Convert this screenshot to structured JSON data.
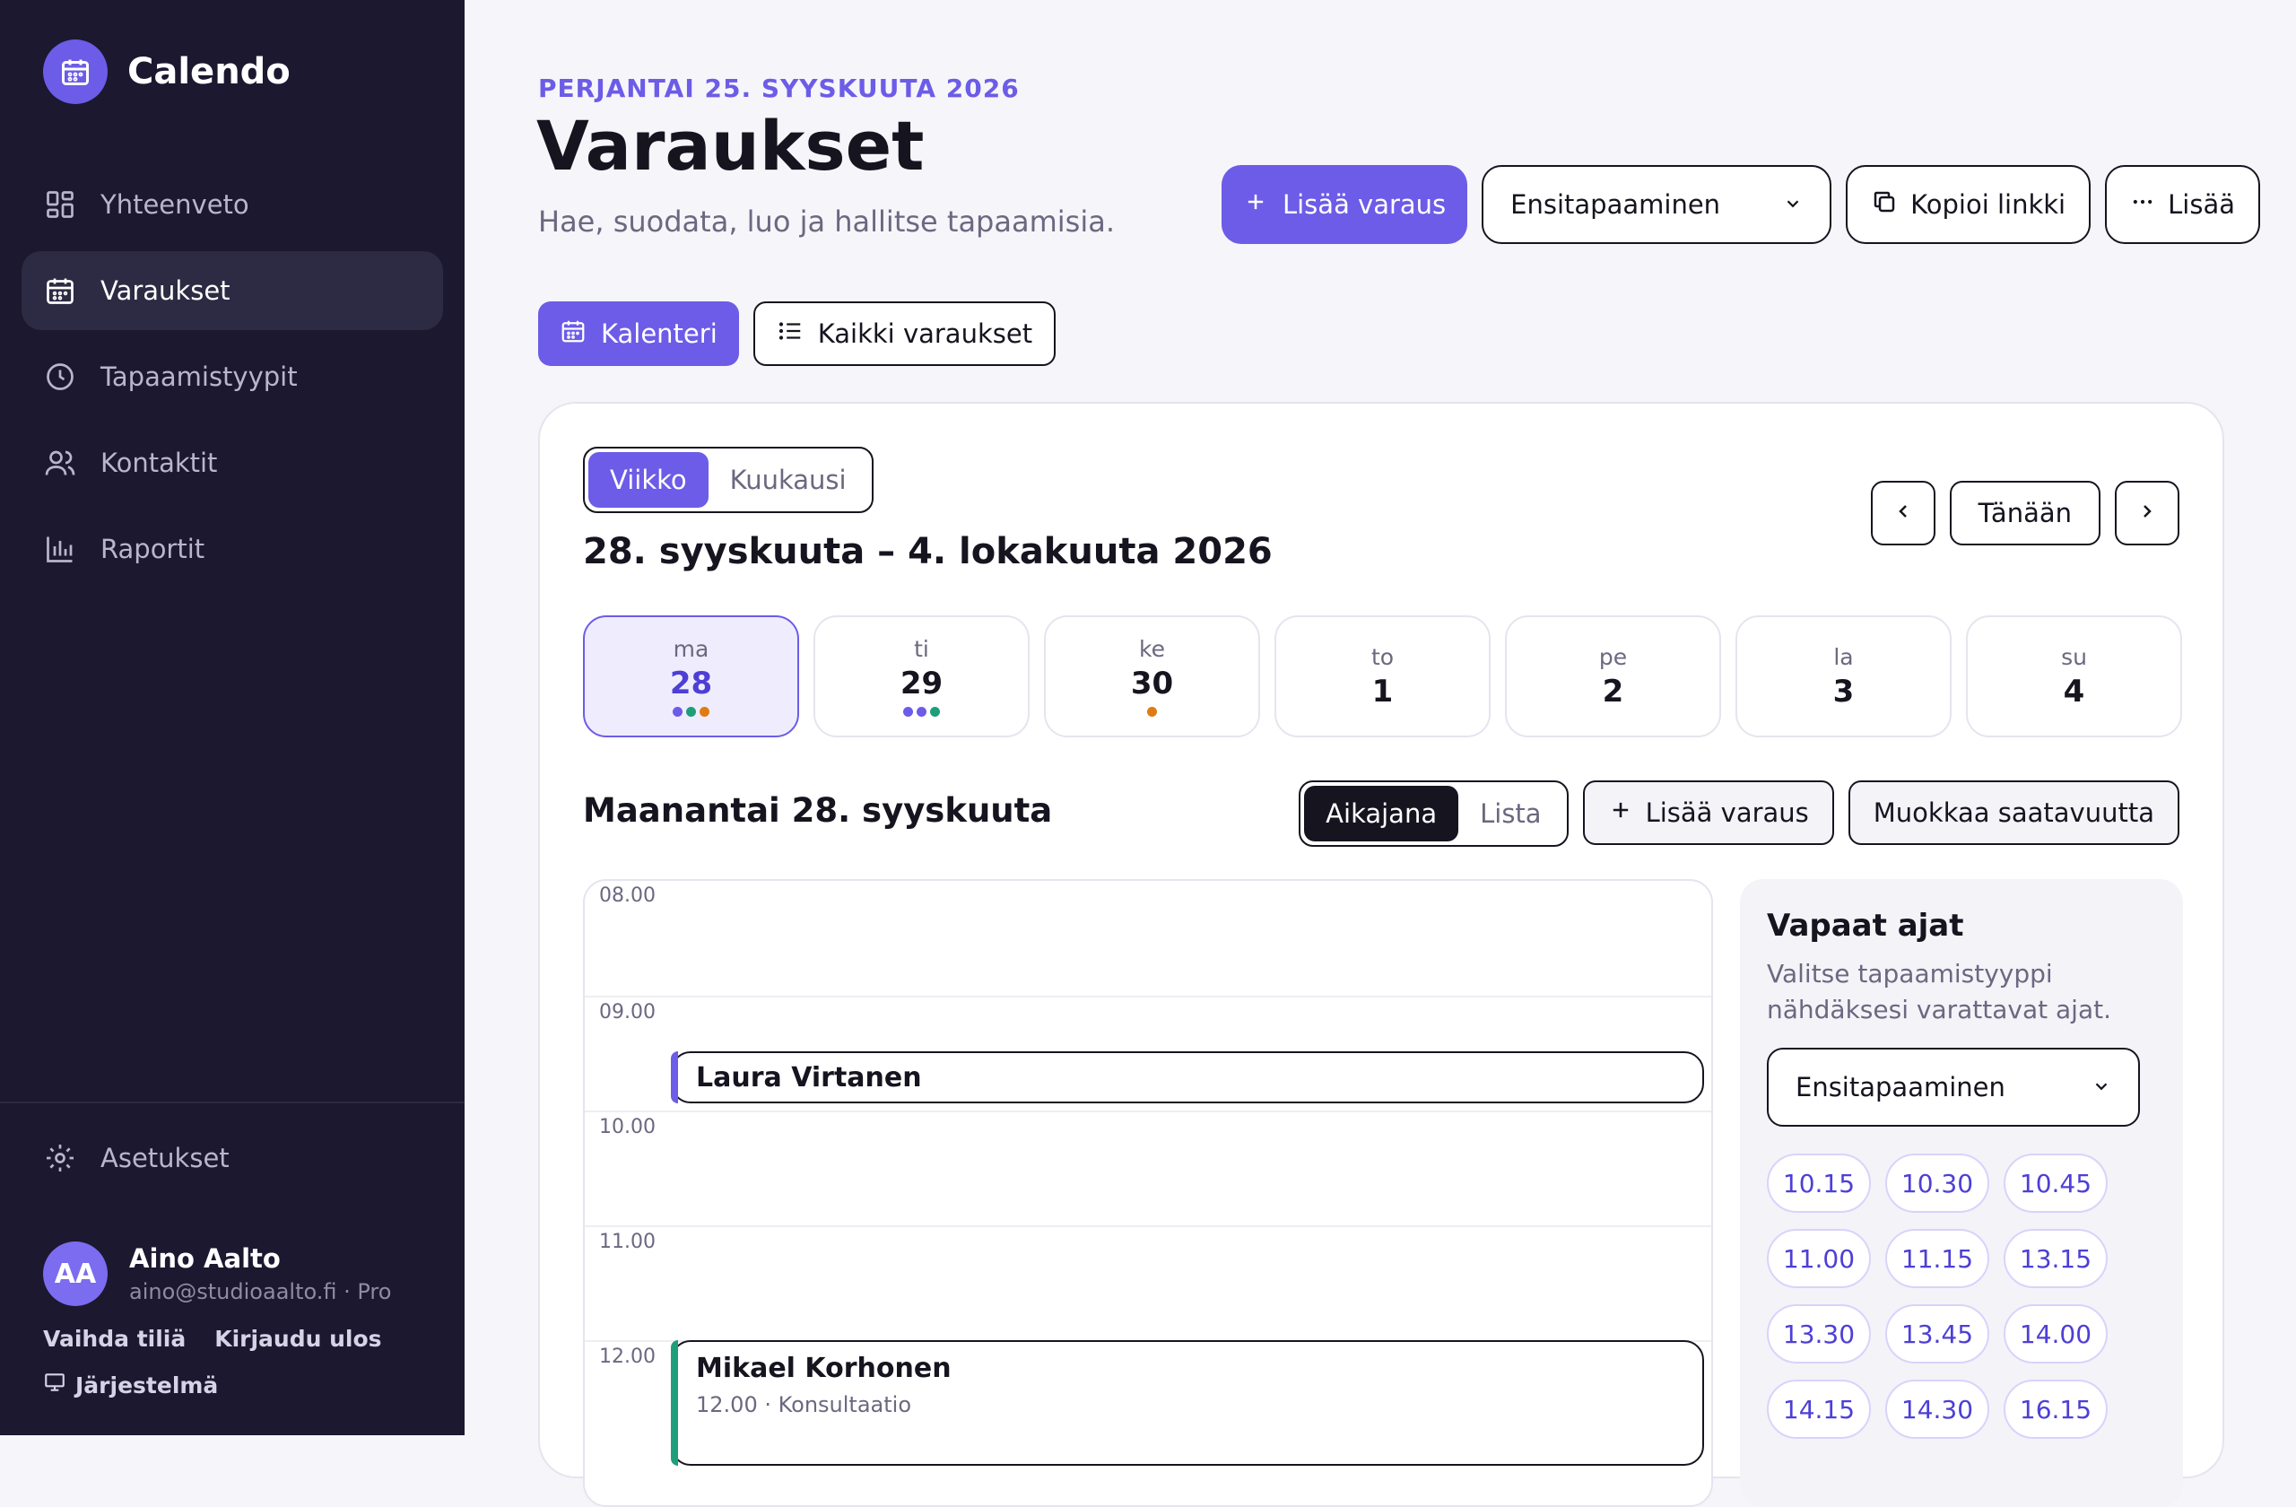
{
  "app": {
    "name": "Calendo"
  },
  "colors": {
    "accent": "#6c5ce7",
    "sidebar": "#1b1830",
    "dot_purple": "#6c5ce7",
    "dot_green": "#1f9e7a",
    "dot_orange": "#e07b14"
  },
  "sidebar": {
    "items": [
      {
        "label": "Yhteenveto",
        "icon": "dashboard-icon"
      },
      {
        "label": "Varaukset",
        "icon": "calendar-icon",
        "active": true
      },
      {
        "label": "Tapaamistyypit",
        "icon": "clock-icon"
      },
      {
        "label": "Kontaktit",
        "icon": "users-icon"
      },
      {
        "label": "Raportit",
        "icon": "bar-chart-icon"
      }
    ],
    "settings": "Asetukset",
    "user": {
      "initials": "AA",
      "name": "Aino Aalto",
      "email": "aino@studioaalto.fi · Pro"
    },
    "links": {
      "switch_account": "Vaihda tiliä",
      "logout": "Kirjaudu ulos",
      "system": "Järjestelmä"
    }
  },
  "header": {
    "date": "PERJANTAI 25. SYYSKUUTA 2026",
    "title": "Varaukset",
    "subtitle": "Hae, suodata, luo ja hallitse tapaamisia.",
    "add_booking": "Lisää varaus",
    "meeting_type": "Ensitapaaminen",
    "copy_link": "Kopioi linkki",
    "more": "Lisää"
  },
  "views": {
    "calendar": "Kalenteri",
    "all": "Kaikki varaukset"
  },
  "calendar": {
    "mode_week": "Viikko",
    "mode_month": "Kuukausi",
    "range": "28. syyskuuta – 4. lokakuuta 2026",
    "today": "Tänään",
    "days": [
      {
        "name": "ma",
        "num": "28",
        "selected": true,
        "dots": [
          "purple",
          "green",
          "orange"
        ]
      },
      {
        "name": "ti",
        "num": "29",
        "dots": [
          "purple",
          "purple",
          "green"
        ]
      },
      {
        "name": "ke",
        "num": "30",
        "dots": [
          "orange"
        ]
      },
      {
        "name": "to",
        "num": "1",
        "dots": []
      },
      {
        "name": "pe",
        "num": "2",
        "dots": []
      },
      {
        "name": "la",
        "num": "3",
        "dots": []
      },
      {
        "name": "su",
        "num": "4",
        "dots": []
      }
    ],
    "day_title": "Maanantai 28. syyskuuta",
    "mode_timeline": "Aikajana",
    "mode_list": "Lista",
    "add_booking": "Lisää varaus",
    "edit_availability": "Muokkaa saatavuutta",
    "hours": [
      "08.00",
      "09.00",
      "10.00",
      "11.00",
      "12.00"
    ],
    "events": [
      {
        "name": "Laura Virtanen",
        "meta": ""
      },
      {
        "name": "Mikael Korhonen",
        "meta": "12.00 · Konsultaatio"
      }
    ]
  },
  "free_slots": {
    "title": "Vapaat ajat",
    "desc": "Valitse tapaamistyyppi nähdäksesi varattavat ajat.",
    "selected_type": "Ensitapaaminen",
    "times": [
      "10.15",
      "10.30",
      "10.45",
      "11.00",
      "11.15",
      "13.15",
      "13.30",
      "13.45",
      "14.00",
      "14.15",
      "14.30",
      "16.15"
    ]
  }
}
